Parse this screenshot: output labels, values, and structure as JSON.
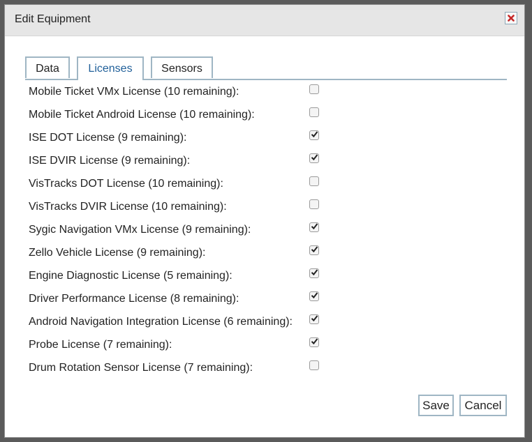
{
  "dialog": {
    "title": "Edit Equipment",
    "close_icon": "close-icon"
  },
  "tabs": [
    {
      "label": "Data",
      "active": false
    },
    {
      "label": "Licenses",
      "active": true
    },
    {
      "label": "Sensors",
      "active": false
    }
  ],
  "licenses": [
    {
      "label": "Mobile Ticket VMx License (10 remaining):",
      "checked": false
    },
    {
      "label": "Mobile Ticket Android License (10 remaining):",
      "checked": false
    },
    {
      "label": "ISE DOT License (9 remaining):",
      "checked": true
    },
    {
      "label": "ISE DVIR License (9 remaining):",
      "checked": true
    },
    {
      "label": "VisTracks DOT License (10 remaining):",
      "checked": false
    },
    {
      "label": "VisTracks DVIR License (10 remaining):",
      "checked": false
    },
    {
      "label": "Sygic Navigation VMx License (9 remaining):",
      "checked": true
    },
    {
      "label": "Zello Vehicle License (9 remaining):",
      "checked": true
    },
    {
      "label": "Engine Diagnostic License (5 remaining):",
      "checked": true
    },
    {
      "label": "Driver Performance License (8 remaining):",
      "checked": true
    },
    {
      "label": "Android Navigation Integration License (6 remaining):",
      "checked": true
    },
    {
      "label": "Probe License (7 remaining):",
      "checked": true
    },
    {
      "label": "Drum Rotation Sensor License (7 remaining):",
      "checked": false
    }
  ],
  "buttons": {
    "save_label": "Save",
    "cancel_label": "Cancel"
  },
  "colors": {
    "accent": "#1f5f99",
    "border": "#9fb6c4",
    "close_x": "#c62828"
  }
}
